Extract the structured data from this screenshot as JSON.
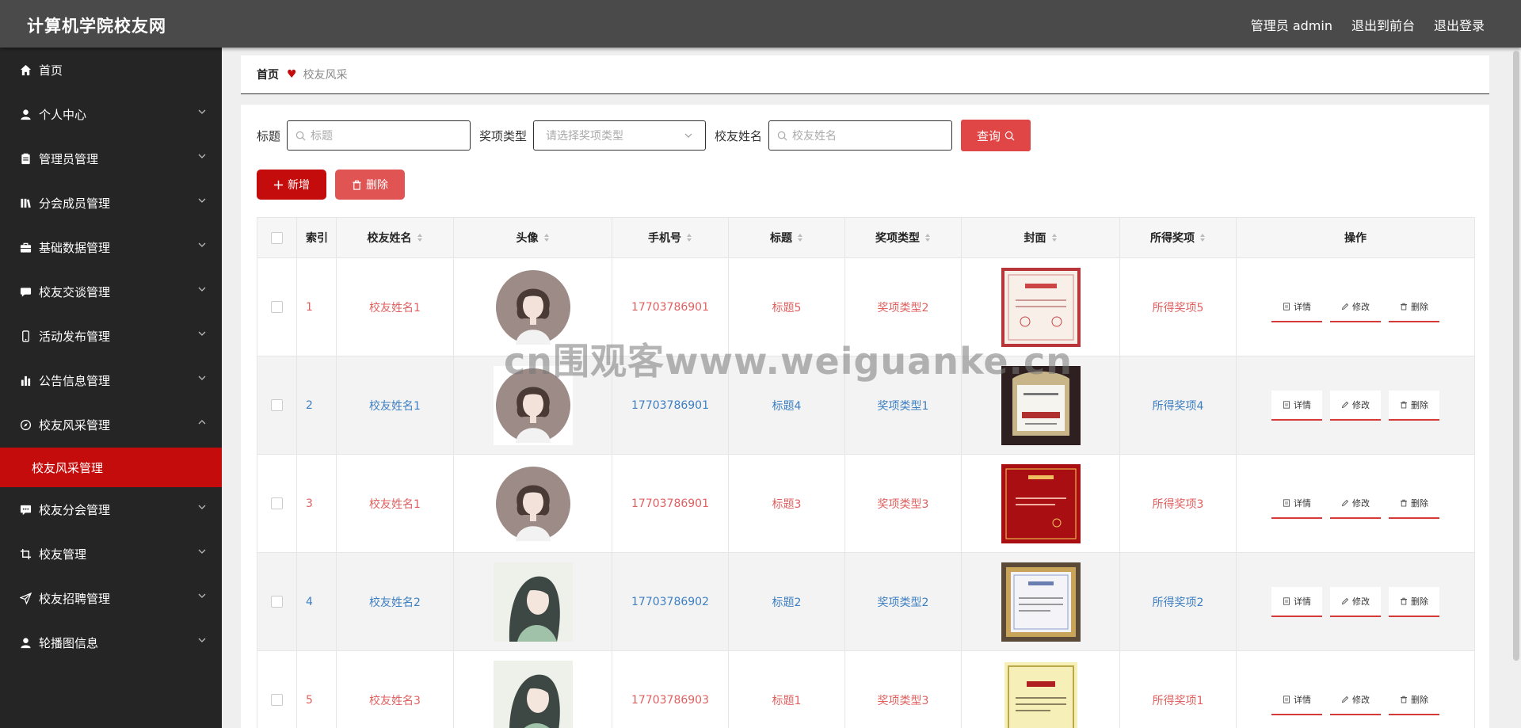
{
  "header": {
    "title": "计算机学院校友网",
    "nav": [
      "管理员 admin",
      "退出到前台",
      "退出登录"
    ]
  },
  "sidebar": {
    "items": [
      {
        "label": "首页",
        "icon": "home-icon"
      },
      {
        "label": "个人中心",
        "icon": "user-icon"
      },
      {
        "label": "管理员管理",
        "icon": "clipboard-icon"
      },
      {
        "label": "分会成员管理",
        "icon": "library-icon"
      },
      {
        "label": "基础数据管理",
        "icon": "briefcase-icon"
      },
      {
        "label": "校友交谈管理",
        "icon": "chat-icon"
      },
      {
        "label": "活动发布管理",
        "icon": "phone-icon"
      },
      {
        "label": "公告信息管理",
        "icon": "bar-chart-icon"
      },
      {
        "label": "校友风采管理",
        "icon": "compass-icon"
      },
      {
        "label": "校友分会管理",
        "icon": "message-icon"
      },
      {
        "label": "校友管理",
        "icon": "crop-icon"
      },
      {
        "label": "校友招聘管理",
        "icon": "send-icon"
      },
      {
        "label": "轮播图信息",
        "icon": "user-icon"
      }
    ],
    "active_sub": "校友风采管理"
  },
  "breadcrumb": {
    "home": "首页",
    "current": "校友风采"
  },
  "search": {
    "title_label": "标题",
    "title_placeholder": "标题",
    "type_label": "奖项类型",
    "type_placeholder": "请选择奖项类型",
    "name_label": "校友姓名",
    "name_placeholder": "校友姓名",
    "query_label": "查询"
  },
  "actions": {
    "add_label": "新增",
    "delete_label": "删除"
  },
  "table": {
    "headers": [
      "索引",
      "校友姓名",
      "头像",
      "手机号",
      "标题",
      "奖项类型",
      "封面",
      "所得奖项",
      "操作"
    ],
    "op_labels": [
      "详情",
      "修改",
      "删除"
    ],
    "rows": [
      {
        "index": "1",
        "name": "校友姓名1",
        "avatar": "avatar-girl-short-hair",
        "phone": "17703786901",
        "title": "标题5",
        "type": "奖项类型2",
        "cover": "certificate-white",
        "award": "所得奖项5",
        "color": "red"
      },
      {
        "index": "2",
        "name": "校友姓名1",
        "avatar": "avatar-girl-short-hair",
        "phone": "17703786901",
        "title": "标题4",
        "type": "奖项类型1",
        "cover": "certificate-framed-dark",
        "award": "所得奖项4",
        "color": "blue"
      },
      {
        "index": "3",
        "name": "校友姓名1",
        "avatar": "avatar-girl-short-hair",
        "phone": "17703786901",
        "title": "标题3",
        "type": "奖项类型3",
        "cover": "certificate-red",
        "award": "所得奖项3",
        "color": "red"
      },
      {
        "index": "4",
        "name": "校友姓名2",
        "avatar": "avatar-girl-long-hair",
        "phone": "17703786902",
        "title": "标题2",
        "type": "奖项类型2",
        "cover": "certificate-framed-gold",
        "award": "所得奖项2",
        "color": "blue"
      },
      {
        "index": "5",
        "name": "校友姓名3",
        "avatar": "avatar-girl-long-hair",
        "phone": "17703786903",
        "title": "标题1",
        "type": "奖项类型3",
        "cover": "certificate-yellow",
        "award": "所得奖项1",
        "color": "red"
      }
    ]
  },
  "watermark": "cn围观客www.weiguanke.cn",
  "colors": {
    "accent": "#c40c0c",
    "header_bg": "#4a4a4a",
    "sidebar_bg": "#252525",
    "link_red": "#e06060",
    "link_blue": "#3d7fc2"
  }
}
